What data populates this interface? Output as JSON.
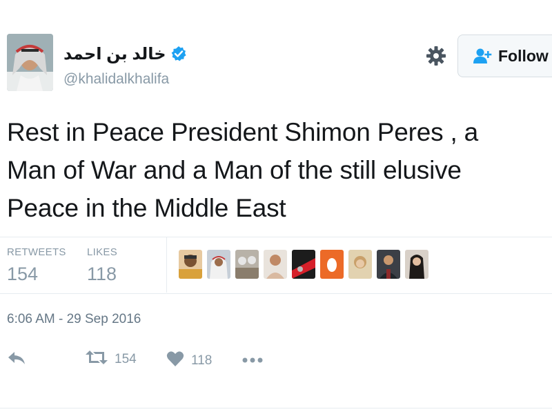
{
  "user": {
    "display_name": "خالد بن احمد",
    "handle": "@khalidalkhalifa"
  },
  "follow_button": {
    "label": "Follow"
  },
  "tweet": {
    "text_lines": [
      "Rest in Peace President Shimon Peres , a",
      "Man of War and a Man of the still elusive",
      "Peace in the Middle East"
    ],
    "timestamp": "6:06 AM - 29 Sep 2016"
  },
  "stats": {
    "retweets_label": "RETWEETS",
    "retweets_value": "154",
    "likes_label": "LIKES",
    "likes_value": "118"
  },
  "actions": {
    "retweet_count": "154",
    "like_count": "118"
  },
  "colors": {
    "verified": "#1da1f2",
    "muted": "#8899a6",
    "divider": "#e6ecf0"
  },
  "icons": [
    "verified-icon",
    "gear-icon",
    "follow-icon",
    "reply-icon",
    "retweet-icon",
    "heart-icon",
    "more-icon"
  ]
}
